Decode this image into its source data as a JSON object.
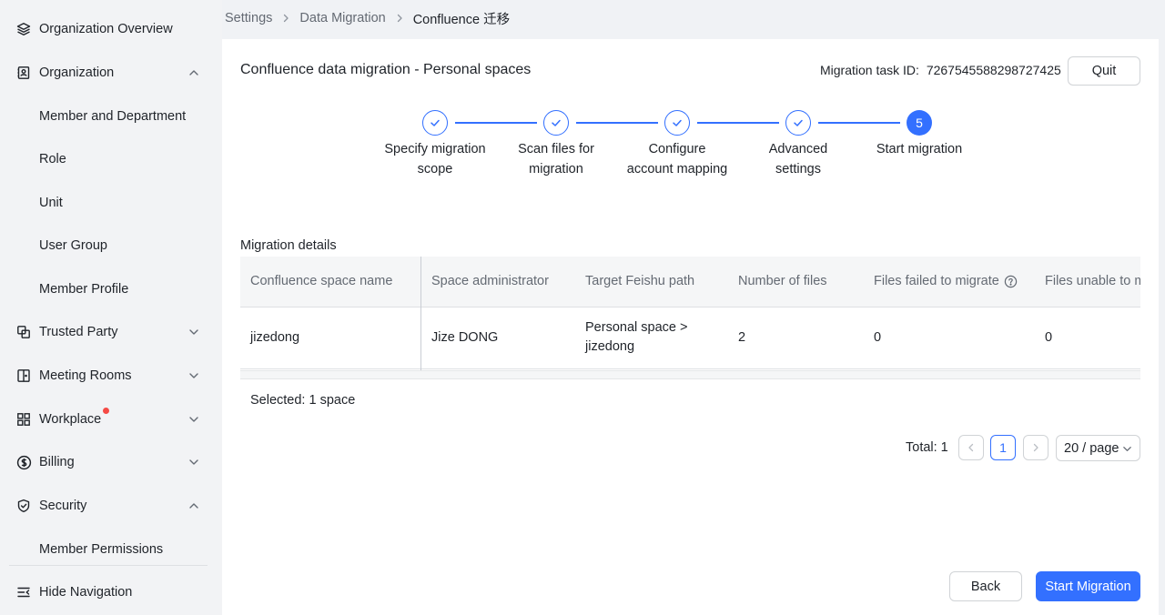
{
  "sidebar": {
    "items": [
      {
        "label": "Organization Overview",
        "icon": "layers-icon"
      },
      {
        "label": "Organization",
        "icon": "contact-card-icon",
        "expanded": true
      },
      {
        "label": "Member and Department"
      },
      {
        "label": "Role"
      },
      {
        "label": "Unit"
      },
      {
        "label": "User Group"
      },
      {
        "label": "Member Profile"
      },
      {
        "label": "Trusted Party",
        "icon": "linked-squares-icon"
      },
      {
        "label": "Meeting Rooms",
        "icon": "door-icon"
      },
      {
        "label": "Workplace",
        "icon": "grid-icon",
        "badge": "red-dot"
      },
      {
        "label": "Billing",
        "icon": "dollar-icon"
      },
      {
        "label": "Security",
        "icon": "shield-icon",
        "expanded": true
      },
      {
        "label": "Member Permissions"
      }
    ],
    "hide_navigation": "Hide Navigation"
  },
  "breadcrumb": {
    "items": [
      "Settings",
      "Data Migration",
      "Confluence 迁移"
    ]
  },
  "header": {
    "title": "Confluence data migration - Personal spaces",
    "task_id_label": "Migration task ID:",
    "task_id_value": "7267545588298727425",
    "quit_label": "Quit"
  },
  "steps": [
    {
      "line1": "Specify migration",
      "line2": "scope",
      "status": "done"
    },
    {
      "line1": "Scan files for",
      "line2": "migration",
      "status": "done"
    },
    {
      "line1": "Configure",
      "line2": "account mapping",
      "status": "done"
    },
    {
      "line1": "Advanced",
      "line2": "settings",
      "status": "done"
    },
    {
      "number": "5",
      "line1": "Start migration",
      "line2": "",
      "status": "active"
    }
  ],
  "details": {
    "title": "Migration details",
    "columns": [
      "Confluence space name",
      "Space administrator",
      "Target Feishu path",
      "Number of files",
      "Files failed to migrate",
      "Files unable to m"
    ],
    "rows": [
      {
        "space": "jizedong",
        "admin": "Jize DONG",
        "path_line1": "Personal space >",
        "path_line2": "jizedong",
        "files": "2",
        "failed": "0",
        "unable": "0"
      }
    ],
    "selected": "Selected: 1 space"
  },
  "pagination": {
    "total": "Total: 1",
    "current_page": "1",
    "page_size": "20 / page"
  },
  "footer": {
    "back_label": "Back",
    "start_label": "Start Migration"
  },
  "colors": {
    "accent": "#3370ff",
    "badge": "#f54a45"
  }
}
